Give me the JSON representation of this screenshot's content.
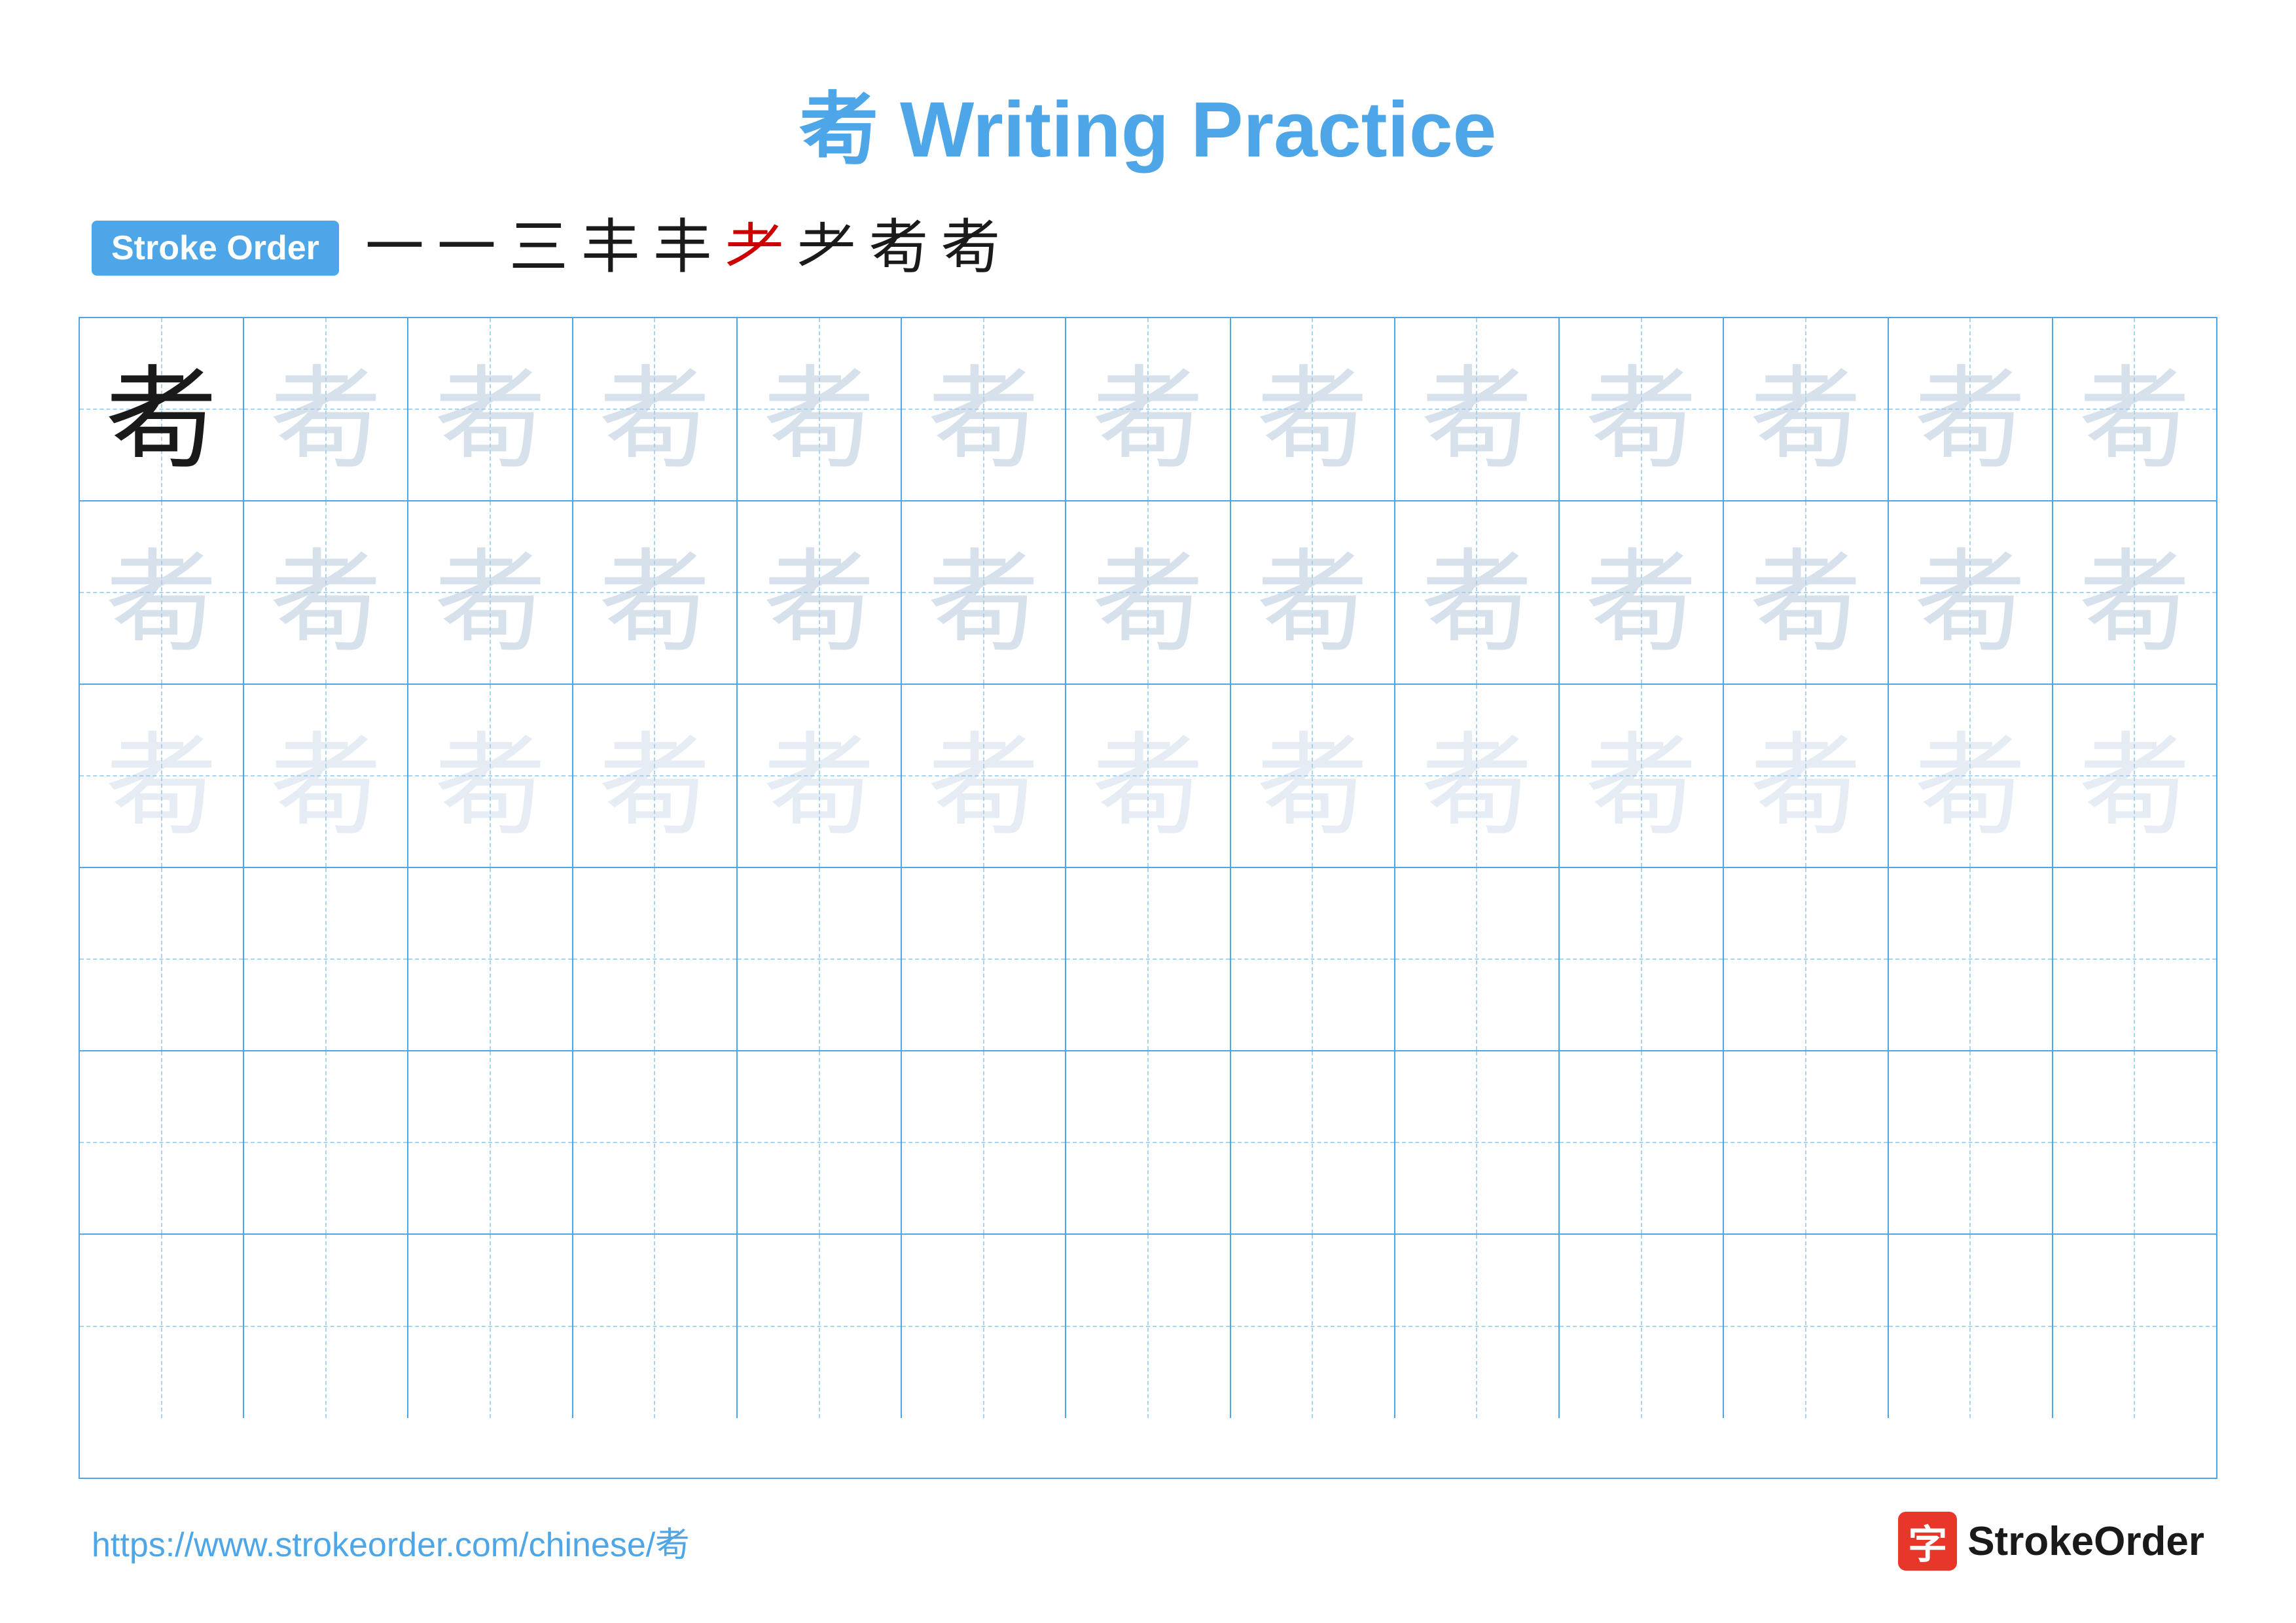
{
  "title": "耇 Writing Practice",
  "stroke_order_label": "Stroke Order",
  "stroke_sequence": [
    "一",
    "一",
    "三",
    "丰",
    "丰",
    "耂",
    "耂",
    "耇",
    "耇"
  ],
  "stroke_colors": [
    "black",
    "black",
    "black",
    "black",
    "black",
    "red",
    "black",
    "black",
    "black"
  ],
  "character": "耇",
  "grid": {
    "rows": 6,
    "cols": 13,
    "row_data": [
      {
        "chars": [
          "dark",
          "light",
          "light",
          "light",
          "light",
          "light",
          "light",
          "light",
          "light",
          "light",
          "light",
          "light",
          "light"
        ]
      },
      {
        "chars": [
          "light",
          "light",
          "light",
          "light",
          "light",
          "light",
          "light",
          "light",
          "light",
          "light",
          "light",
          "light",
          "light"
        ]
      },
      {
        "chars": [
          "very-light",
          "very-light",
          "very-light",
          "very-light",
          "very-light",
          "very-light",
          "very-light",
          "very-light",
          "very-light",
          "very-light",
          "very-light",
          "very-light",
          "very-light"
        ]
      },
      {
        "chars": [
          "empty",
          "empty",
          "empty",
          "empty",
          "empty",
          "empty",
          "empty",
          "empty",
          "empty",
          "empty",
          "empty",
          "empty",
          "empty"
        ]
      },
      {
        "chars": [
          "empty",
          "empty",
          "empty",
          "empty",
          "empty",
          "empty",
          "empty",
          "empty",
          "empty",
          "empty",
          "empty",
          "empty",
          "empty"
        ]
      },
      {
        "chars": [
          "empty",
          "empty",
          "empty",
          "empty",
          "empty",
          "empty",
          "empty",
          "empty",
          "empty",
          "empty",
          "empty",
          "empty",
          "empty"
        ]
      }
    ]
  },
  "footer": {
    "url": "https://www.strokeorder.com/chinese/耇",
    "logo_char": "字",
    "logo_text": "StrokeOrder"
  }
}
